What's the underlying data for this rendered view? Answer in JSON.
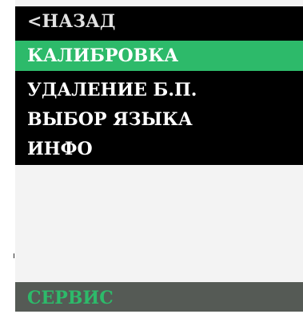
{
  "menu": {
    "items": [
      {
        "label": "<НАЗАД"
      },
      {
        "label": "КАЛИБРОВКА"
      },
      {
        "label": "УДАЛЕНИЕ Б.П."
      },
      {
        "label": "ВЫБОР ЯЗЫКА"
      },
      {
        "label": "ИНФО"
      }
    ],
    "selected_index": 1
  },
  "footer": {
    "title": "СЕРВИС"
  },
  "colors": {
    "menu_background": "#000000",
    "selection": "#2dba6a",
    "screen_background": "#f3f3f3",
    "footer_background": "#555a55",
    "footer_text": "#2dba6a"
  }
}
